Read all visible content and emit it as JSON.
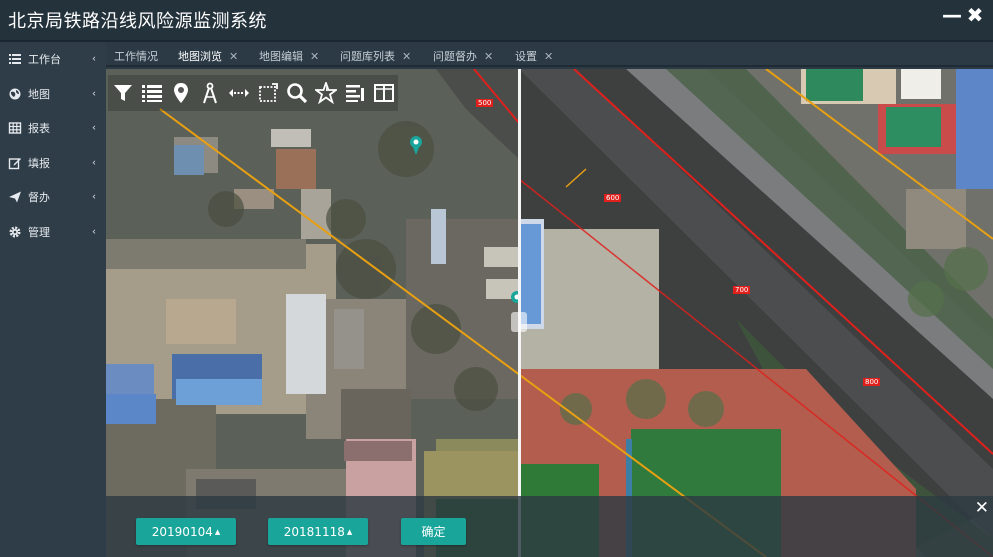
{
  "app": {
    "title": "北京局铁路沿线风险源监测系统"
  },
  "window": {
    "minimize_glyph": "—",
    "close_glyph": "✖"
  },
  "sidebar": {
    "items": [
      {
        "label": "工作台",
        "icon": "list-icon"
      },
      {
        "label": "地图",
        "icon": "globe-icon"
      },
      {
        "label": "报表",
        "icon": "grid-icon"
      },
      {
        "label": "填报",
        "icon": "edit-icon"
      },
      {
        "label": "督办",
        "icon": "send-icon"
      },
      {
        "label": "管理",
        "icon": "gear-icon"
      }
    ],
    "chevron": "‹"
  },
  "tabs": [
    {
      "label": "工作情况",
      "closable": false
    },
    {
      "label": "地图浏览",
      "closable": true,
      "active": true
    },
    {
      "label": "地图编辑",
      "closable": true
    },
    {
      "label": "问题库列表",
      "closable": true
    },
    {
      "label": "问题督办",
      "closable": true
    },
    {
      "label": "设置",
      "closable": true
    }
  ],
  "toolbar": {
    "tools": [
      "filter-icon",
      "layers-list-icon",
      "location-pin-icon",
      "compass-icon",
      "measure-distance-icon",
      "measure-area-icon",
      "search-icon",
      "favorite-icon",
      "legend-icon",
      "split-view-icon"
    ]
  },
  "map": {
    "labels": [
      "500",
      "600",
      "700",
      "800"
    ],
    "colors": {
      "railway_boundary": "#e0201c",
      "power_line": "#e8a012",
      "swipe": "#f5f5f5"
    }
  },
  "time_panel": {
    "date_left": "20190104",
    "date_right": "20181118",
    "confirm_label": "确定",
    "caret": "▲",
    "close_glyph": "✕"
  }
}
